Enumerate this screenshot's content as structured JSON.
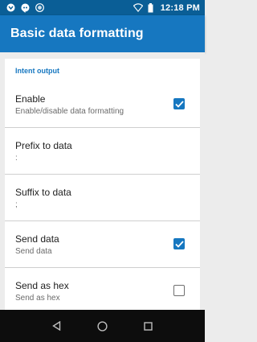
{
  "status_bar": {
    "time": "12:18 PM",
    "left_icons": [
      "notification-icon",
      "hangouts-icon",
      "sync-icon"
    ],
    "right_icons": [
      "wifi-icon",
      "battery-icon"
    ]
  },
  "app_bar": {
    "title": "Basic data formatting"
  },
  "section": {
    "title": "Intent output"
  },
  "preferences": [
    {
      "title": "Enable",
      "summary": "Enable/disable data formatting",
      "checkbox": true
    },
    {
      "title": "Prefix to data",
      "summary": ":"
    },
    {
      "title": "Suffix to data",
      "summary": ";"
    },
    {
      "title": "Send data",
      "summary": "Send data",
      "checkbox": true
    },
    {
      "title": "Send as hex",
      "summary": "Send as hex",
      "checkbox": false
    }
  ],
  "nav_bar": {
    "buttons": [
      "back-icon",
      "home-icon",
      "recents-icon"
    ]
  },
  "colors": {
    "primary": "#1677c0",
    "primary_dark": "#0a5e96",
    "background": "#ececec"
  }
}
